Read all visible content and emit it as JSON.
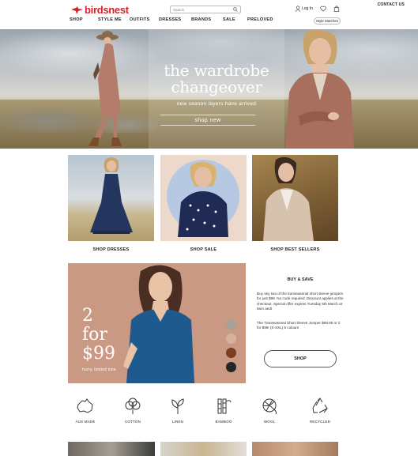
{
  "header": {
    "contact": "CONTACT US",
    "brand": "birdsnest",
    "search_placeholder": "Search",
    "login": "Log In",
    "brand_color": "#d3222a"
  },
  "nav": {
    "items": [
      "SHOP",
      "STYLE ME",
      "OUTFITS",
      "DRESSES",
      "BRANDS",
      "SALE",
      "PRELOVED"
    ],
    "style_matches": "Style Matches"
  },
  "hero": {
    "title_line1": "the wardrobe",
    "title_line2": "changeover",
    "subtitle": "new season layers have arrived",
    "button": "shop new"
  },
  "tiles": [
    {
      "label": "SHOP DRESSES"
    },
    {
      "label": "SHOP SALE"
    },
    {
      "label": "SHOP BEST SELLERS"
    }
  ],
  "promo": {
    "line1": "2",
    "line2": "for",
    "line3": "$99",
    "note": "hurry, limited time",
    "swatch_colors": [
      "#a9a197",
      "#d7b39e",
      "#7b3e1f",
      "#262626"
    ]
  },
  "buy_save": {
    "title": "BUY & SAVE",
    "para1": "Buy any two of the transeasonal short sleeve jumpers for just $99. No code required. Discount applies at the checkout. Special offer expires Tuesday 5th March at 9am aedt",
    "para2": "The Transeasonal Short Sleeve Jumper $69.95 or 2 for $99! (S-XXL) 5 colours",
    "button": "SHOP"
  },
  "features": [
    {
      "label": "AUS MADE",
      "icon": "australia-icon"
    },
    {
      "label": "COTTON",
      "icon": "cotton-icon"
    },
    {
      "label": "LINEN",
      "icon": "linen-icon"
    },
    {
      "label": "BAMBOO",
      "icon": "bamboo-icon"
    },
    {
      "label": "WOOL",
      "icon": "wool-icon"
    },
    {
      "label": "RECYCLED",
      "icon": "recycle-icon"
    }
  ]
}
